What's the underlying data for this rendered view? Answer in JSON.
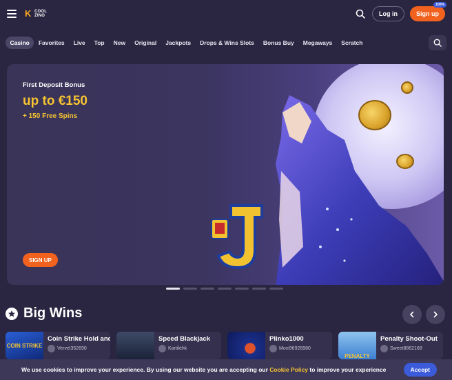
{
  "header": {
    "logo_line1": "COOL",
    "logo_line2": "ZINO",
    "login_label": "Log in",
    "signup_label": "Sign up",
    "signup_badge": "100%"
  },
  "categories": {
    "items": [
      "Casino",
      "Favorites",
      "Live",
      "Top",
      "New",
      "Original",
      "Jackpots",
      "Drops & Wins Slots",
      "Bonus Buy",
      "Megaways",
      "Scratch"
    ],
    "active": "Casino"
  },
  "banner": {
    "title": "First Deposit Bonus",
    "amount": "up to €150",
    "spins": "+ 150 Free Spins",
    "button_label": "SIGN UP"
  },
  "carousel": {
    "slide_count": 7,
    "active_index": 0
  },
  "big_wins": {
    "title": "Big Wins",
    "items": [
      {
        "game": "Coin Strike Hold and Win",
        "user": "Vervel352690",
        "thumb_label": "COIN STRIKE"
      },
      {
        "game": "Speed Blackjack",
        "user": "Kartikthk",
        "thumb_label": ""
      },
      {
        "game": "Plinko1000",
        "user": "Moxi96928980",
        "thumb_label": ""
      },
      {
        "game": "Penalty Shoot-Out",
        "user": "Sweet8862168",
        "thumb_label": "PENALTY"
      }
    ]
  },
  "cookie": {
    "text_before": "We use cookies to improve your experience. By using our website you are accepting our ",
    "link": "Cookie Policy",
    "text_after": " to improve your experience",
    "accept_label": "Accept"
  },
  "colors": {
    "background": "#2a2540",
    "accent_orange": "#f2621f",
    "accent_yellow": "#f7c431",
    "accent_blue": "#3b5bdb"
  }
}
